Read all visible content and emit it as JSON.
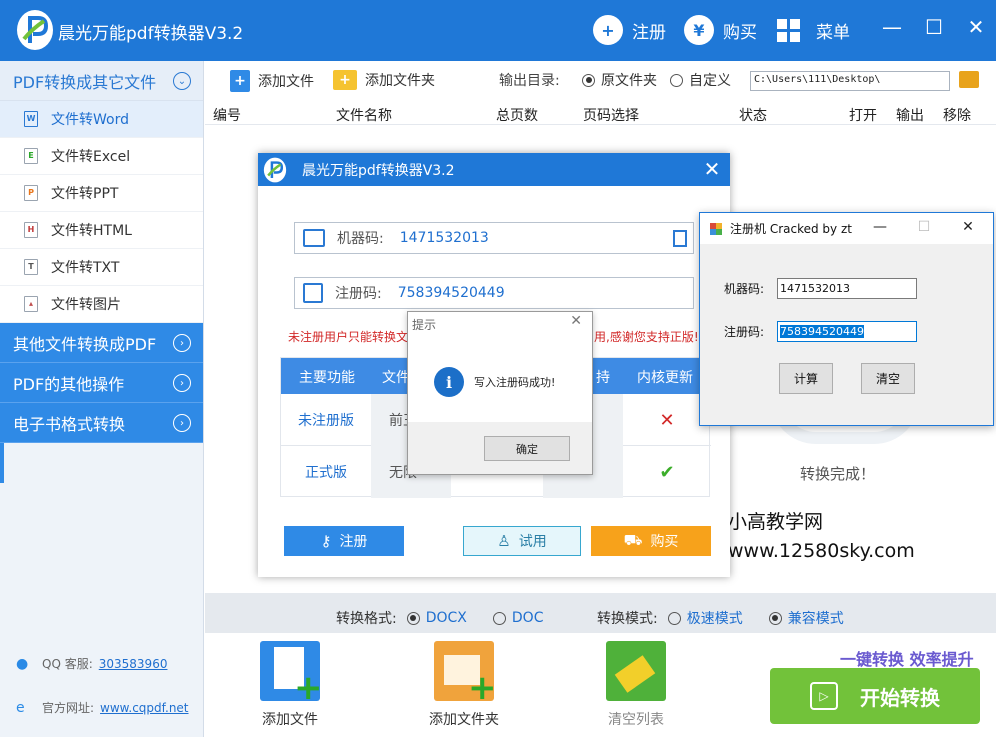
{
  "app": {
    "title": "晨光万能pdf转换器V3.2",
    "register_label": "注册",
    "buy_label": "购买",
    "menu_label": "菜单"
  },
  "sidebar": {
    "categories": [
      {
        "label": "PDF转换成其它文件",
        "expanded": true
      },
      {
        "label": "其他文件转换成PDF"
      },
      {
        "label": "PDF的其他操作"
      },
      {
        "label": "电子书格式转换"
      }
    ],
    "items": [
      {
        "label": "文件转Word",
        "icon": "W",
        "selected": true
      },
      {
        "label": "文件转Excel",
        "icon": "E"
      },
      {
        "label": "文件转PPT",
        "icon": "P"
      },
      {
        "label": "文件转HTML",
        "icon": "H"
      },
      {
        "label": "文件转TXT",
        "icon": "T"
      },
      {
        "label": "文件转图片",
        "icon": "img"
      }
    ],
    "qq_label": "QQ 客服:",
    "qq_value": "303583960",
    "site_label": "官方网址:",
    "site_value": "www.cqpdf.net"
  },
  "toolbar": {
    "add_file": "添加文件",
    "add_folder": "添加文件夹",
    "output_label": "输出目录:",
    "opt_source": "原文件夹",
    "opt_custom": "自定义",
    "path_value": "C:\\Users\\111\\Desktop\\"
  },
  "columns": [
    "编号",
    "文件名称",
    "总页数",
    "页码选择",
    "状态",
    "打开",
    "输出",
    "移除"
  ],
  "list": {
    "status_text": "转换完成！",
    "watermark_name": "小高教学网",
    "watermark_url": "www.12580sky.com"
  },
  "format_bar": {
    "format_label": "转换格式:",
    "opt_docx": "DOCX",
    "opt_doc": "DOC",
    "mode_label": "转换模式:",
    "opt_fast": "极速模式",
    "opt_compat": "兼容模式"
  },
  "bottom": {
    "add_file": "添加文件",
    "add_folder": "添加文件夹",
    "clear_list": "清空列表",
    "slogan": "一键转换  效率提升",
    "start": "开始转换"
  },
  "reg_dialog": {
    "title": "晨光万能pdf转换器V3.2",
    "machine_label": "机器码:",
    "machine_value": "1471532013",
    "code_label": "注册码:",
    "code_value": "758394520449",
    "warning_start": "未注册用户只能转换文",
    "warning_end": "用,感谢您支持正版!",
    "table_headers": [
      "主要功能",
      "文件",
      "持",
      "内核更新"
    ],
    "row_unreg": "未注册版",
    "row_unreg_val": "前王",
    "row_reg": "正式版",
    "row_reg_val": "无限",
    "btn_register": "注册",
    "btn_trial": "试用",
    "btn_buy": "购买"
  },
  "msgbox": {
    "title": "提示",
    "text": "写入注册码成功!",
    "ok": "确定"
  },
  "keygen": {
    "title": "注册机 Cracked by zt",
    "machine_label": "机器码:",
    "machine_value": "1471532013",
    "code_label": "注册码:",
    "code_value": "758394520449",
    "btn_calc": "计算",
    "btn_clear": "清空"
  },
  "colors": {
    "brand_blue": "#1f78d7",
    "start_green": "#72c23a",
    "buy_orange": "#f7a21b",
    "warning_red": "#d22828"
  }
}
